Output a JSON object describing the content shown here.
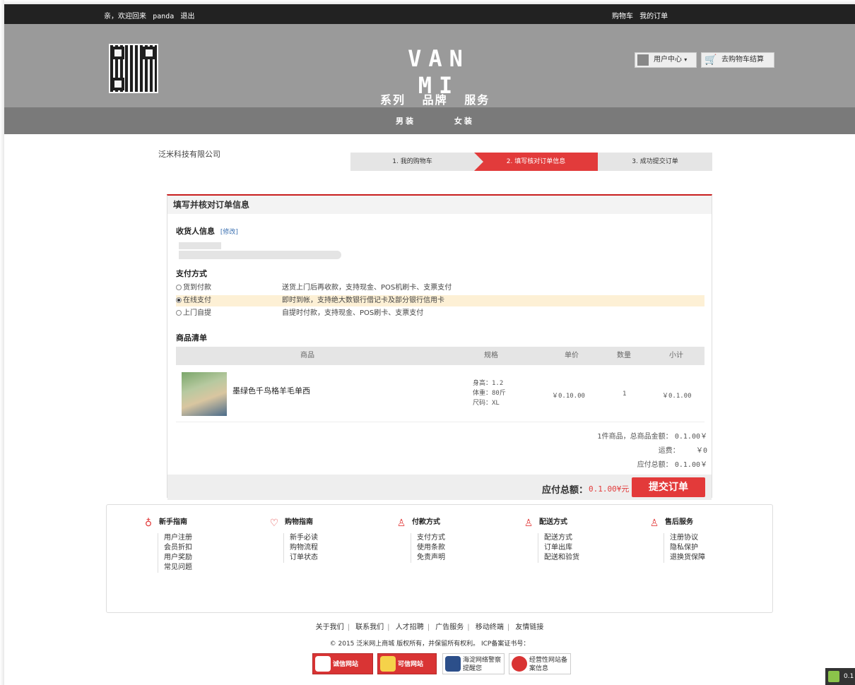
{
  "topbar": {
    "welcome": "亲，欢迎回来",
    "username": "panda",
    "logout": "退出",
    "cart": "购物车",
    "my_orders": "我的订单"
  },
  "header": {
    "logo": "VAN MI",
    "nav": [
      "系列",
      "品牌",
      "服务"
    ],
    "user_center": "用户中心",
    "cart_checkout": "去购物车结算",
    "subnav": [
      "男装",
      "女装"
    ]
  },
  "company": "泛米科技有限公司",
  "steps": [
    "1. 我的购物车",
    "2. 填写核对订单信息",
    "3. 成功提交订单"
  ],
  "order": {
    "title": "填写并核对订单信息",
    "receiver_label": "收货人信息",
    "modify": "[修改]",
    "payment_label": "支付方式",
    "payments": [
      {
        "name": "货到付款",
        "desc": "送货上门后再收款，支持现金、POS机刷卡、支票支付",
        "selected": false
      },
      {
        "name": "在线支付",
        "desc": "即时到帐，支持绝大数银行借记卡及部分银行信用卡",
        "selected": true
      },
      {
        "name": "上门自提",
        "desc": "自提时付款，支持现金、POS刷卡、支票支付",
        "selected": false
      }
    ],
    "list_label": "商品清单",
    "columns": [
      "商品",
      "规格",
      "单价",
      "数量",
      "小计"
    ],
    "item": {
      "name": "墨绿色千鸟格羊毛单西",
      "spec": [
        "身高：1.2",
        "体重：80斤",
        "尺码：XL"
      ],
      "unit_price": "￥0.10.00",
      "quantity": "1",
      "subtotal": "￥0.1.00"
    },
    "summary": {
      "items_total": "1件商品，总商品金额：",
      "items_total_value": "0.1.00￥",
      "shipping_label": "运费：",
      "shipping_value": "￥0",
      "payable_label": "应付总额：",
      "payable_value": "0.1.00￥"
    },
    "total_label": "应付总额：",
    "total_value": "0.1.00¥元",
    "submit": "提交订单"
  },
  "footer": {
    "columns": [
      {
        "title": "新手指南",
        "icon": "location-pin-icon",
        "links": [
          "用户注册",
          "会员折扣",
          "用户奖励",
          "常见问题"
        ]
      },
      {
        "title": "购物指南",
        "icon": "heart-icon",
        "links": [
          "新手必读",
          "购物流程",
          "订单状态"
        ]
      },
      {
        "title": "付款方式",
        "icon": "user-icon",
        "links": [
          "支付方式",
          "使用条款",
          "免责声明"
        ]
      },
      {
        "title": "配送方式",
        "icon": "user-icon",
        "links": [
          "配送方式",
          "订单出库",
          "配送和验货"
        ]
      },
      {
        "title": "售后服务",
        "icon": "user-icon",
        "links": [
          "注册协议",
          "隐私保护",
          "退换货保障"
        ]
      }
    ],
    "bottom_links": [
      "关于我们",
      "联系我们",
      "人才招聘",
      "广告服务",
      "移动终端",
      "友情链接"
    ],
    "copyright": "© 2015 泛米网上商城 版权所有，并保留所有权利。 ICP备案证书号：",
    "badges": [
      "诚信网站",
      "可信网站",
      "海淀网络警察提醒您",
      "经营性网站备案信息"
    ],
    "corner": "0.1"
  }
}
